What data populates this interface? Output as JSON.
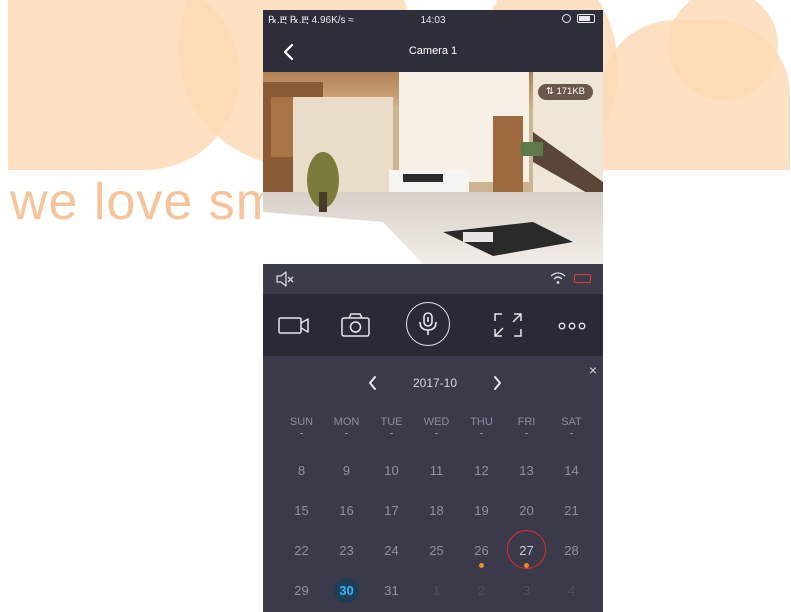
{
  "watermark": {
    "text": "we love smart"
  },
  "status_bar": {
    "left": "℞.Ⰱ ℞.Ⰱ 4.96K/s ≈",
    "time": "14:03"
  },
  "header": {
    "title": "Camera 1",
    "back_icon": "chevron-left-icon"
  },
  "video": {
    "bitrate": "171KB",
    "bitrate_icon": "arrows-updown-icon"
  },
  "video_bar": {
    "mute_icon": "speaker-muted-icon",
    "wifi_icon": "wifi-icon",
    "battery_icon": "battery-low-icon",
    "battery_color": "#e0393e"
  },
  "toolbar": {
    "record_icon": "video-camera-icon",
    "snapshot_icon": "camera-icon",
    "talk_icon": "microphone-icon",
    "fullscreen_icon": "expand-icon",
    "more_icon": "more-icon"
  },
  "calendar": {
    "close_label": "×",
    "month_label": "2017-10",
    "weekdays": [
      "SUN",
      "MON",
      "TUE",
      "WED",
      "THU",
      "FRI",
      "SAT"
    ],
    "weeks": [
      [
        {
          "d": "8"
        },
        {
          "d": "9"
        },
        {
          "d": "10"
        },
        {
          "d": "11"
        },
        {
          "d": "12"
        },
        {
          "d": "13"
        },
        {
          "d": "14"
        }
      ],
      [
        {
          "d": "15"
        },
        {
          "d": "16"
        },
        {
          "d": "17"
        },
        {
          "d": "18"
        },
        {
          "d": "19"
        },
        {
          "d": "20"
        },
        {
          "d": "21"
        }
      ],
      [
        {
          "d": "22"
        },
        {
          "d": "23"
        },
        {
          "d": "24"
        },
        {
          "d": "25"
        },
        {
          "d": "26",
          "dot": true
        },
        {
          "d": "27",
          "dot": true,
          "selected": true
        },
        {
          "d": "28"
        }
      ],
      [
        {
          "d": "29"
        },
        {
          "d": "30",
          "today": true
        },
        {
          "d": "31"
        },
        {
          "d": "1",
          "muted": true
        },
        {
          "d": "2",
          "muted": true
        },
        {
          "d": "3",
          "muted": true
        },
        {
          "d": "4",
          "muted": true
        }
      ]
    ],
    "colors": {
      "today": "#2fb8ff",
      "recording_dot": "#f08a24",
      "selected_ring": "#e02a2a"
    }
  }
}
